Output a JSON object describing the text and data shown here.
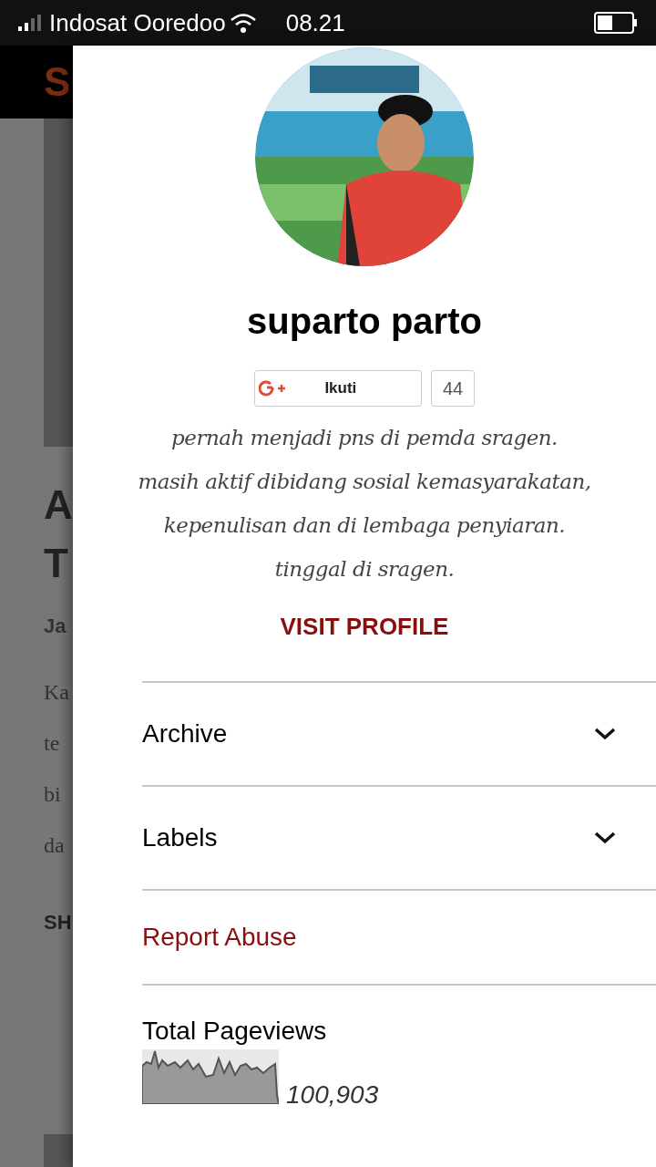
{
  "status_bar": {
    "carrier": "Indosat Ooredoo",
    "time": "08.21"
  },
  "background_page": {
    "logo": "S",
    "heading_lines": [
      "A",
      "T"
    ],
    "date": "Ja",
    "body_lines": [
      "Ka",
      "te",
      "bi",
      "da"
    ],
    "share": "SH"
  },
  "profile": {
    "name": "suparto parto",
    "follow_button": "Ikuti",
    "follower_count": "44",
    "bio_lines": [
      "pernah menjadi pns di pemda sragen.",
      "masih aktif dibidang sosial kemasyarakatan,",
      "kepenulisan dan di lembaga penyiaran.",
      "tinggal di sragen."
    ],
    "visit_link": "VISIT PROFILE"
  },
  "sections": [
    {
      "kind": "expandable",
      "label": "Archive",
      "expanded": false
    },
    {
      "kind": "expandable",
      "label": "Labels",
      "expanded": false
    },
    {
      "kind": "link",
      "label": "Report Abuse"
    }
  ],
  "pageviews": {
    "title": "Total Pageviews",
    "count": "100,903"
  }
}
